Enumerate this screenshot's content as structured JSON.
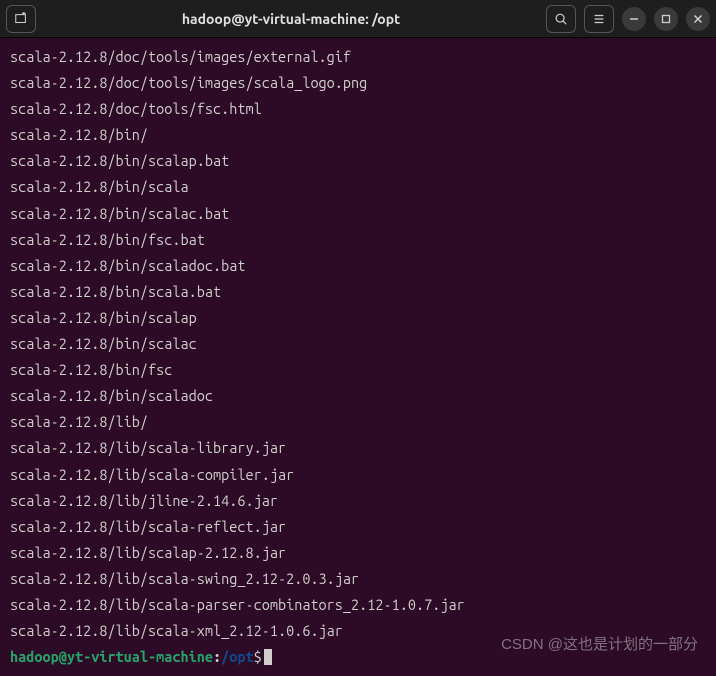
{
  "titlebar": {
    "title": "hadoop@yt-virtual-machine: /opt"
  },
  "terminal": {
    "lines": [
      "scala-2.12.8/doc/tools/images/external.gif",
      "scala-2.12.8/doc/tools/images/scala_logo.png",
      "scala-2.12.8/doc/tools/fsc.html",
      "scala-2.12.8/bin/",
      "scala-2.12.8/bin/scalap.bat",
      "scala-2.12.8/bin/scala",
      "scala-2.12.8/bin/scalac.bat",
      "scala-2.12.8/bin/fsc.bat",
      "scala-2.12.8/bin/scaladoc.bat",
      "scala-2.12.8/bin/scala.bat",
      "scala-2.12.8/bin/scalap",
      "scala-2.12.8/bin/scalac",
      "scala-2.12.8/bin/fsc",
      "scala-2.12.8/bin/scaladoc",
      "scala-2.12.8/lib/",
      "scala-2.12.8/lib/scala-library.jar",
      "scala-2.12.8/lib/scala-compiler.jar",
      "scala-2.12.8/lib/jline-2.14.6.jar",
      "scala-2.12.8/lib/scala-reflect.jar",
      "scala-2.12.8/lib/scalap-2.12.8.jar",
      "scala-2.12.8/lib/scala-swing_2.12-2.0.3.jar",
      "scala-2.12.8/lib/scala-parser-combinators_2.12-1.0.7.jar",
      "scala-2.12.8/lib/scala-xml_2.12-1.0.6.jar"
    ],
    "prompt": {
      "user_host": "hadoop@yt-virtual-machine",
      "colon": ":",
      "path": "/opt",
      "dollar": "$"
    }
  },
  "watermark": "CSDN @这也是计划的一部分"
}
